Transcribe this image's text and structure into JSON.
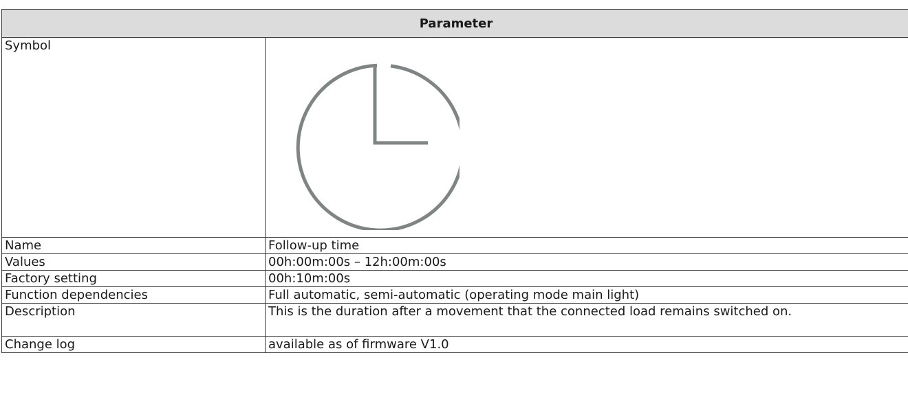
{
  "table": {
    "header": "Parameter",
    "symbol_label": "Symbol",
    "symbol_icon": "clock-icon",
    "rows": [
      {
        "label": "Name",
        "value": "Follow-up time",
        "bold": true
      },
      {
        "label": "Values",
        "value": "00h:00m:00s – 12h:00m:00s"
      },
      {
        "label": "Factory setting",
        "value": "00h:10m:00s"
      },
      {
        "label": "Function dependencies",
        "value": "Full automatic, semi-automatic (operating mode main light)"
      },
      {
        "label": "Description",
        "value": "This is the duration after a movement that the connected load remains switched on."
      },
      {
        "label": "Change log",
        "value": "available as of firmware V1.0"
      }
    ]
  },
  "colors": {
    "header_bg": "#dcdcdc",
    "border": "#3a3a3a",
    "icon_stroke": "#7f8584"
  }
}
